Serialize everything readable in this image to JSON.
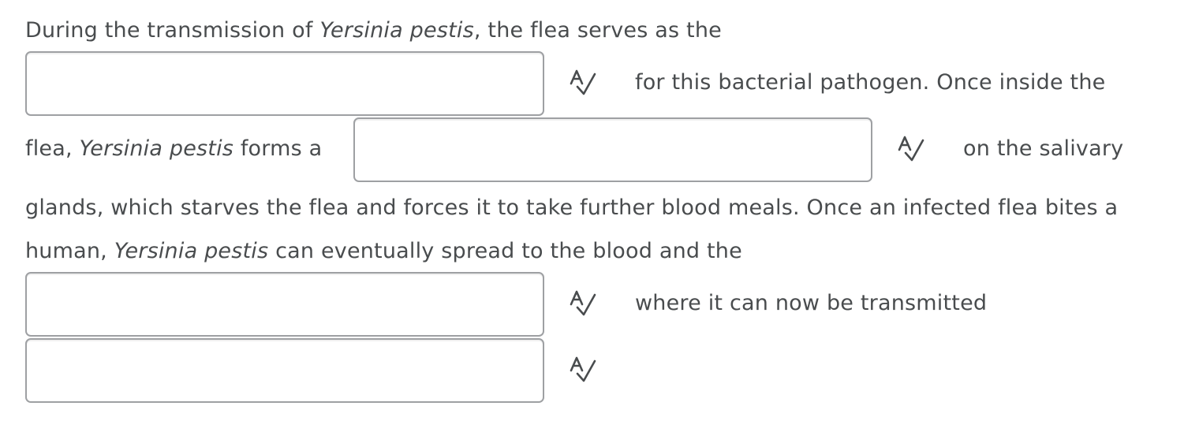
{
  "question": {
    "line1": {
      "pre": "During the transmission of ",
      "organism": "Yersinia pestis",
      "post": ", the flea serves as the"
    },
    "after_blank1": "for this bacterial pathogen. Once inside the",
    "line3": {
      "pre": "flea, ",
      "organism": "Yersinia pestis",
      "post": " forms a"
    },
    "after_blank2": "on the salivary",
    "line4": "glands, which starves the flea and forces it to take further blood meals. Once an infected flea bites a",
    "line5": {
      "pre": "human, ",
      "organism": "Yersinia pestis",
      "post": " can eventually spread to the blood and the"
    },
    "after_blank3": "where it can now be transmitted"
  },
  "blanks": [
    {
      "value": "",
      "placeholder": ""
    },
    {
      "value": "",
      "placeholder": ""
    },
    {
      "value": "",
      "placeholder": ""
    },
    {
      "value": "",
      "placeholder": ""
    }
  ],
  "icons": {
    "spellcheck": "spellcheck-icon",
    "color": "#494c4e"
  }
}
